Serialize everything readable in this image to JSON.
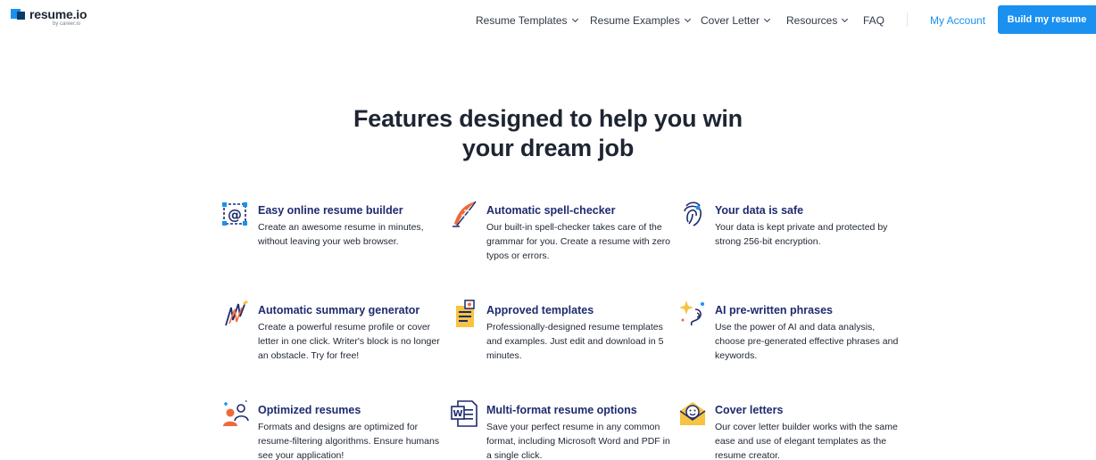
{
  "header": {
    "logo_name": "resume.io",
    "logo_sub": "by career.io",
    "nav": [
      {
        "label": "Resume Templates",
        "dropdown": true
      },
      {
        "label": "Resume Examples",
        "dropdown": true
      },
      {
        "label": "Cover Letter",
        "dropdown": true
      },
      {
        "label": "Resources",
        "dropdown": true
      },
      {
        "label": "FAQ",
        "dropdown": false
      }
    ],
    "account_label": "My Account",
    "cta_label": "Build my resume"
  },
  "main": {
    "heading_line1": "Features designed to help you win",
    "heading_line2": "your dream job",
    "features": [
      {
        "title": "Easy online resume builder",
        "desc": "Create an awesome resume in minutes, without leaving your web browser.",
        "icon": "at-sign-frame-icon"
      },
      {
        "title": "Automatic spell-checker",
        "desc": "Our built-in spell-checker takes care of the grammar for you. Create a resume with zero typos or errors.",
        "icon": "feather-pen-icon"
      },
      {
        "title": "Your data is safe",
        "desc": "Your data is kept private and protected by strong 256-bit encryption.",
        "icon": "fingerprint-shield-icon"
      },
      {
        "title": "Automatic summary generator",
        "desc": "Create a powerful resume profile or cover letter in one click. Writer's block is no longer an obstacle. Try for free!",
        "icon": "writing-lines-icon"
      },
      {
        "title": "Approved templates",
        "desc": "Professionally-designed resume templates and examples. Just edit and download in 5 minutes.",
        "icon": "document-template-icon"
      },
      {
        "title": "AI pre-written phrases",
        "desc": "Use the power of AI and data analysis, choose pre-generated effective phrases and keywords.",
        "icon": "ai-sparkle-icon"
      },
      {
        "title": "Optimized resumes",
        "desc": "Formats and designs are optimized for resume-filtering algorithms. Ensure humans see your application!",
        "icon": "people-target-icon"
      },
      {
        "title": "Multi-format resume options",
        "desc": "Save your perfect resume in any common format, including Microsoft Word and PDF in a single click.",
        "icon": "word-document-icon"
      },
      {
        "title": "Cover letters",
        "desc": "Our cover letter builder works with the same ease and use of elegant templates as the resume creator.",
        "icon": "envelope-smile-icon"
      }
    ]
  },
  "colors": {
    "accent": "#1a91f0",
    "feature_title": "#1e2b6e",
    "icon_orange": "#ef6a3a",
    "icon_yellow": "#f6c343",
    "icon_navy": "#1e2b6e"
  }
}
